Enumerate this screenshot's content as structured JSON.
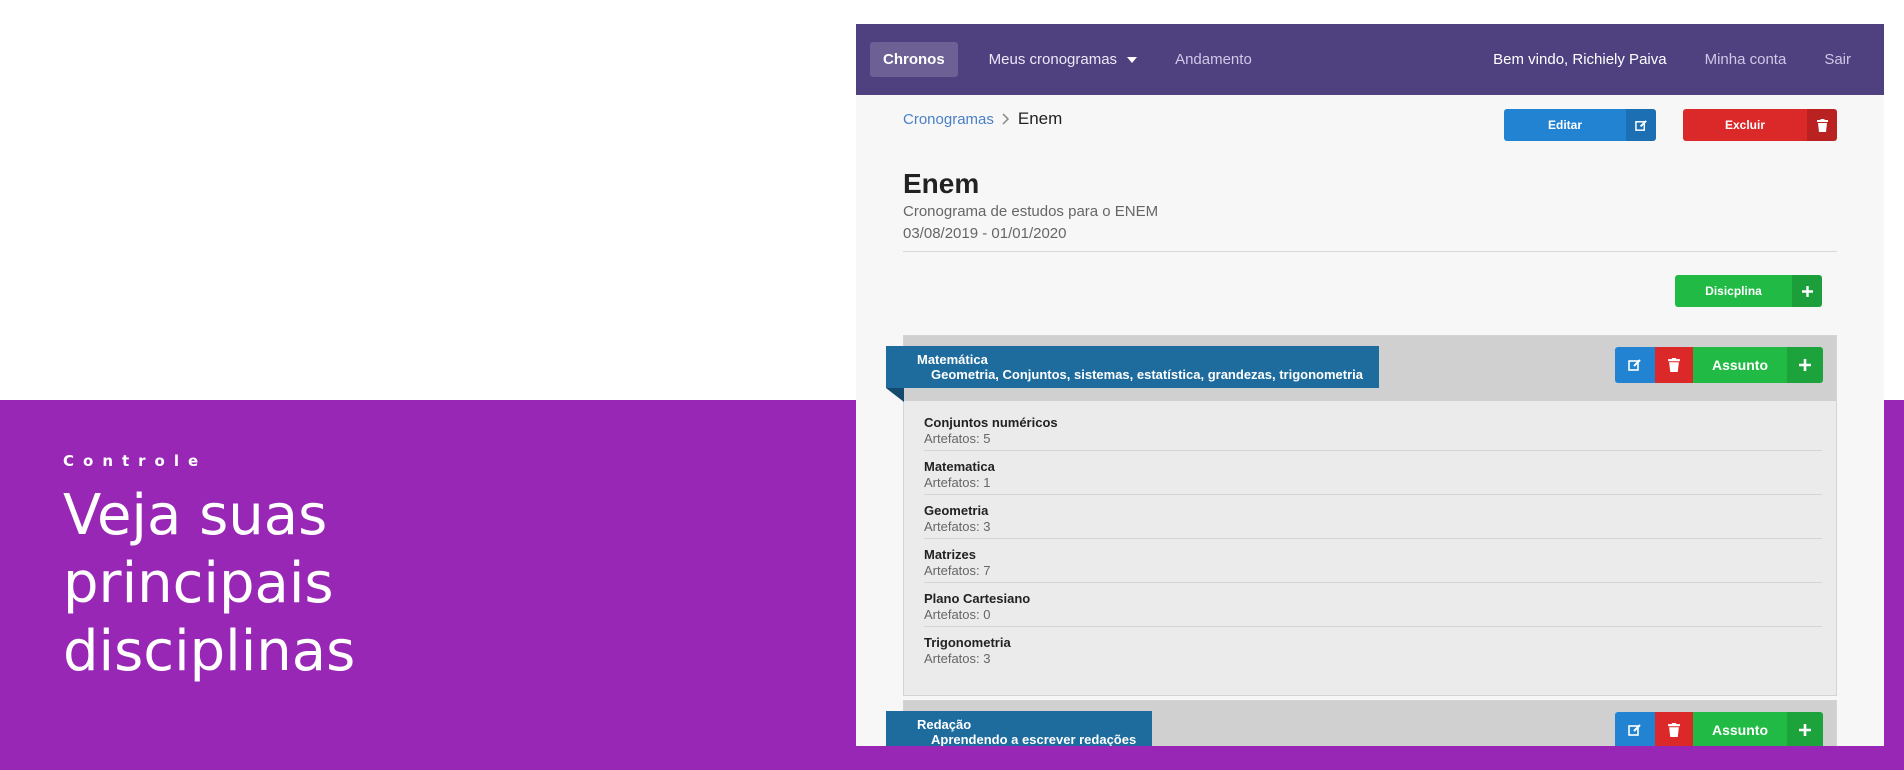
{
  "promo": {
    "eyebrow": "Controle",
    "title": "Veja suas principais disciplinas"
  },
  "navbar": {
    "brand": "Chronos",
    "my_schedules": "Meus cronogramas",
    "progress": "Andamento",
    "welcome": "Bem vindo, Richiely Paiva",
    "account": "Minha conta",
    "logout": "Sair"
  },
  "breadcrumb": {
    "parent": "Cronogramas",
    "current": "Enem"
  },
  "actions": {
    "edit": "Editar",
    "delete": "Excluir",
    "add_discipline": "Disicplina"
  },
  "schedule": {
    "title": "Enem",
    "description": "Cronograma de estudos para o ENEM",
    "dates": "03/08/2019 - 01/01/2020"
  },
  "disciplines": [
    {
      "name": "Matemática",
      "topics_summary": "Geometria, Conjuntos, sistemas, estatística, grandezas, trigonometria",
      "add_subject": "Assunto",
      "subjects": [
        {
          "name": "Conjuntos numéricos",
          "count": "Artefatos: 5"
        },
        {
          "name": "Matematica",
          "count": "Artefatos: 1"
        },
        {
          "name": "Geometria",
          "count": "Artefatos: 3"
        },
        {
          "name": "Matrizes",
          "count": "Artefatos: 7"
        },
        {
          "name": "Plano Cartesiano",
          "count": "Artefatos: 0"
        },
        {
          "name": "Trigonometria",
          "count": "Artefatos: 3"
        }
      ]
    },
    {
      "name": "Redação",
      "topics_summary": "Aprendendo a escrever redações",
      "add_subject": "Assunto",
      "subjects": []
    }
  ],
  "colors": {
    "promo_band": "#9727b4",
    "navbar": "#4f4080",
    "edit_blue": "#2183d2",
    "delete_red": "#db2828",
    "add_green": "#21ba45",
    "ribbon_blue": "#1e6b9e"
  },
  "icons": {
    "edit": "edit-icon",
    "delete": "trash-icon",
    "add": "plus-icon",
    "dropdown": "caret-down-icon",
    "breadcrumb_separator": "chevron-right-icon"
  }
}
